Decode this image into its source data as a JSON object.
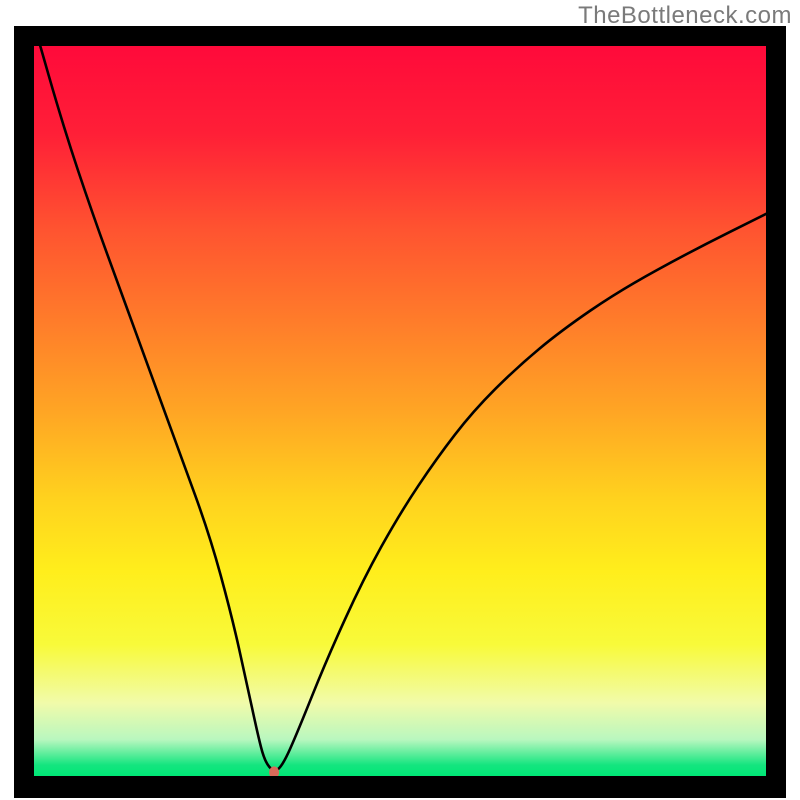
{
  "watermark": "TheBottleneck.com",
  "chart_data": {
    "type": "line",
    "title": "",
    "xlabel": "",
    "ylabel": "",
    "xlim": [
      0,
      100
    ],
    "ylim": [
      0,
      100
    ],
    "grid": false,
    "legend": false,
    "background_gradient": {
      "stops": [
        {
          "pos": 0.0,
          "color": "#ff0a3a"
        },
        {
          "pos": 0.12,
          "color": "#ff1f37"
        },
        {
          "pos": 0.25,
          "color": "#ff5330"
        },
        {
          "pos": 0.38,
          "color": "#ff7d2a"
        },
        {
          "pos": 0.5,
          "color": "#ffa524"
        },
        {
          "pos": 0.62,
          "color": "#ffd21e"
        },
        {
          "pos": 0.72,
          "color": "#ffee1c"
        },
        {
          "pos": 0.82,
          "color": "#f8fa3a"
        },
        {
          "pos": 0.9,
          "color": "#f1fbaa"
        },
        {
          "pos": 0.95,
          "color": "#b9f7bf"
        },
        {
          "pos": 0.985,
          "color": "#14e57f"
        },
        {
          "pos": 1.0,
          "color": "#00e676"
        }
      ]
    },
    "series": [
      {
        "name": "bottleneck-curve",
        "x": [
          0,
          4,
          8,
          12,
          16,
          20,
          24,
          27,
          29,
          30.5,
          31.5,
          32.8,
          34,
          36,
          40,
          45,
          50,
          55,
          60,
          66,
          72,
          80,
          90,
          100
        ],
        "y": [
          103,
          89,
          77,
          66,
          55,
          44,
          33,
          22,
          13,
          6,
          2,
          0.5,
          1.5,
          6,
          16,
          27,
          36,
          43.5,
          50,
          56,
          61,
          66.5,
          72,
          77
        ]
      }
    ],
    "marker": {
      "name": "minimum-marker",
      "x": 32.8,
      "y": 0.5,
      "color": "#d96a5a",
      "rx": 5,
      "ry": 6
    }
  }
}
